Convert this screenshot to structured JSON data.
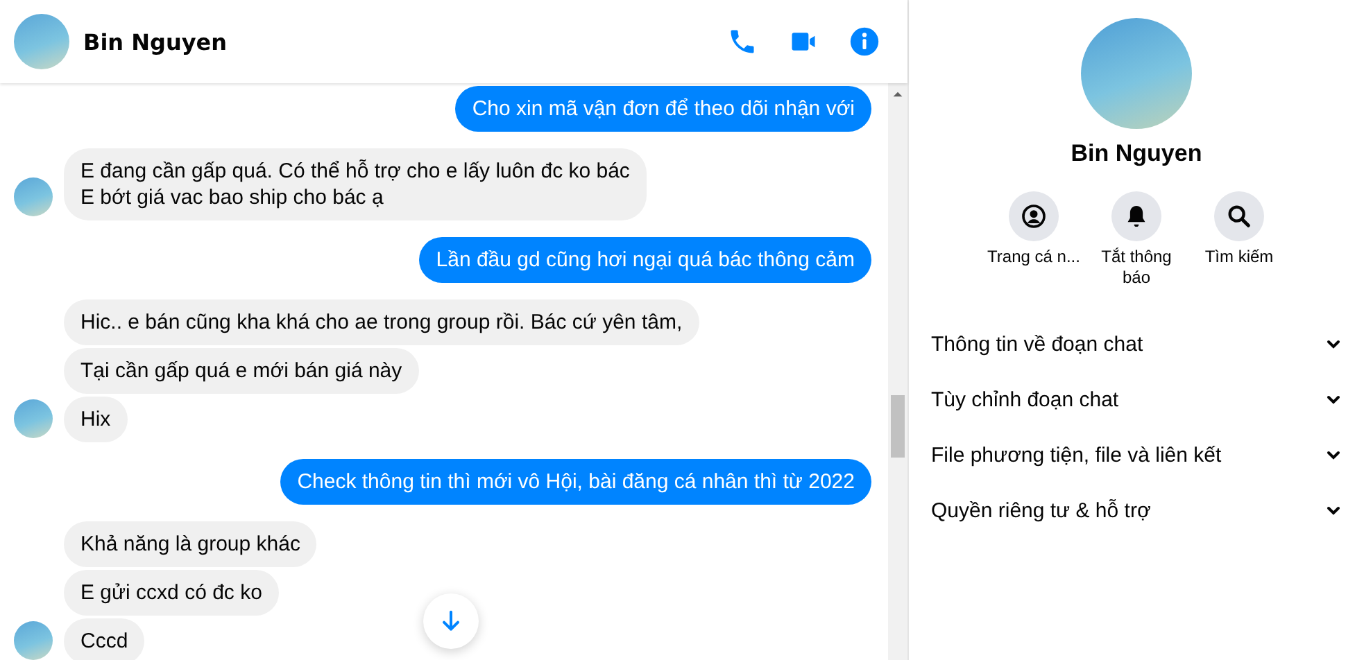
{
  "header": {
    "name": "Bin Nguyen"
  },
  "messages": [
    {
      "kind": "sent",
      "text": "Cho xin mã vận đơn để theo dõi nhận với"
    },
    {
      "kind": "received",
      "text": "E đang cần gấp quá. Có thể hỗ trợ cho e lấy luôn đc ko bác\nE bớt giá vac bao ship cho bác ạ"
    },
    {
      "kind": "sent",
      "text": "Lần đầu gd cũng hơi ngại quá bác thông cảm"
    },
    {
      "kind": "received",
      "text": "Hic.. e bán cũng kha khá cho ae trong group rồi. Bác cứ yên tâm,"
    },
    {
      "kind": "received",
      "text": "Tại cần gấp quá e mới bán giá này"
    },
    {
      "kind": "received",
      "text": "Hix"
    },
    {
      "kind": "sent",
      "text": "Check thông tin thì mới vô Hội, bài đăng cá nhân thì từ 2022"
    },
    {
      "kind": "received",
      "text": "Khả năng là group khác"
    },
    {
      "kind": "received",
      "text": "E gửi ccxd có đc ko"
    },
    {
      "kind": "received",
      "text": "Cccd"
    }
  ],
  "profile": {
    "name": "Bin Nguyen",
    "actions": [
      {
        "kind": "profile",
        "label": "Trang cá n..."
      },
      {
        "kind": "mute",
        "label": "Tắt thông báo"
      },
      {
        "kind": "search",
        "label": "Tìm kiếm"
      }
    ],
    "sections": [
      {
        "label": "Thông tin về đoạn chat",
        "expanded": false
      },
      {
        "label": "Tùy chỉnh đoạn chat",
        "expanded": false
      },
      {
        "label": "File phương tiện, file và liên kết",
        "expanded": false
      },
      {
        "label": "Quyền riêng tư & hỗ trợ",
        "expanded": false
      }
    ]
  }
}
